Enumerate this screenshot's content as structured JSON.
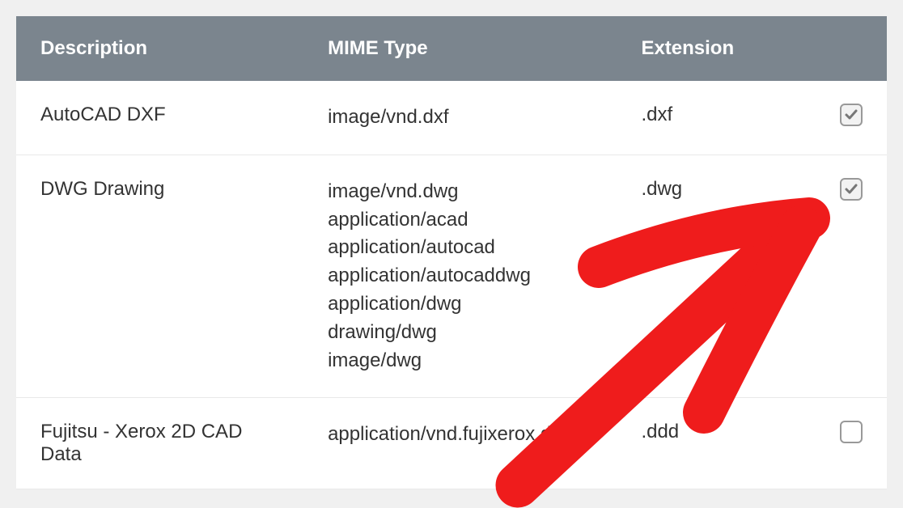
{
  "table": {
    "headers": {
      "description": "Description",
      "mime": "MIME Type",
      "extension": "Extension"
    },
    "rows": [
      {
        "description": "AutoCAD DXF",
        "mimes": [
          "image/vnd.dxf"
        ],
        "extension": ".dxf",
        "checked": true
      },
      {
        "description": "DWG Drawing",
        "mimes": [
          "image/vnd.dwg",
          "application/acad",
          "application/autocad",
          "application/autocaddwg",
          "application/dwg",
          "drawing/dwg",
          "image/dwg"
        ],
        "extension": ".dwg",
        "checked": true
      },
      {
        "description": "Fujitsu - Xerox 2D CAD Data",
        "mimes": [
          "application/vnd.fujixerox.ddd"
        ],
        "extension": ".ddd",
        "checked": false
      }
    ]
  },
  "annotation": {
    "type": "hand-drawn-arrow",
    "color": "#ef1c1c"
  }
}
